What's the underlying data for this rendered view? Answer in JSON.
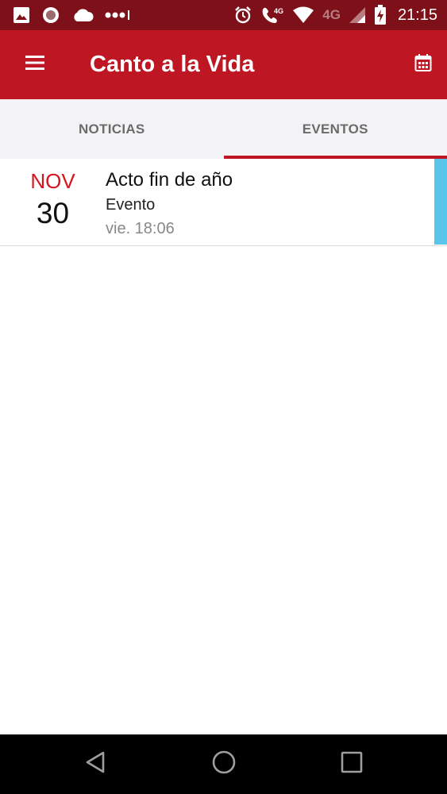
{
  "status_bar": {
    "network_label": "4G",
    "call_network_label": "4G",
    "time": "21:15",
    "icons": [
      "image-icon",
      "record-icon",
      "cloud-icon",
      "more-dots-icon",
      "alarm-icon",
      "wifi-call-icon",
      "wifi-icon",
      "signal-icon",
      "battery-charging-icon"
    ]
  },
  "app_bar": {
    "title": "Canto a la Vida",
    "icons": [
      "menu-icon",
      "calendar-icon"
    ]
  },
  "tabs": [
    {
      "label": "NOTICIAS",
      "active": false
    },
    {
      "label": "EVENTOS",
      "active": true
    }
  ],
  "events": [
    {
      "month": "NOV",
      "day": "30",
      "title": "Acto fin de año",
      "type": "Evento",
      "time": "vie. 18:06",
      "accent_color": "#58c6ea"
    }
  ],
  "nav_bar": {
    "icons": [
      "back-icon",
      "home-icon",
      "recents-icon"
    ]
  },
  "colors": {
    "status_bar": "#7d1019",
    "app_bar": "#be1622",
    "tab_indicator": "#be1622",
    "month_text": "#d7141e",
    "event_accent": "#58c6ea"
  }
}
